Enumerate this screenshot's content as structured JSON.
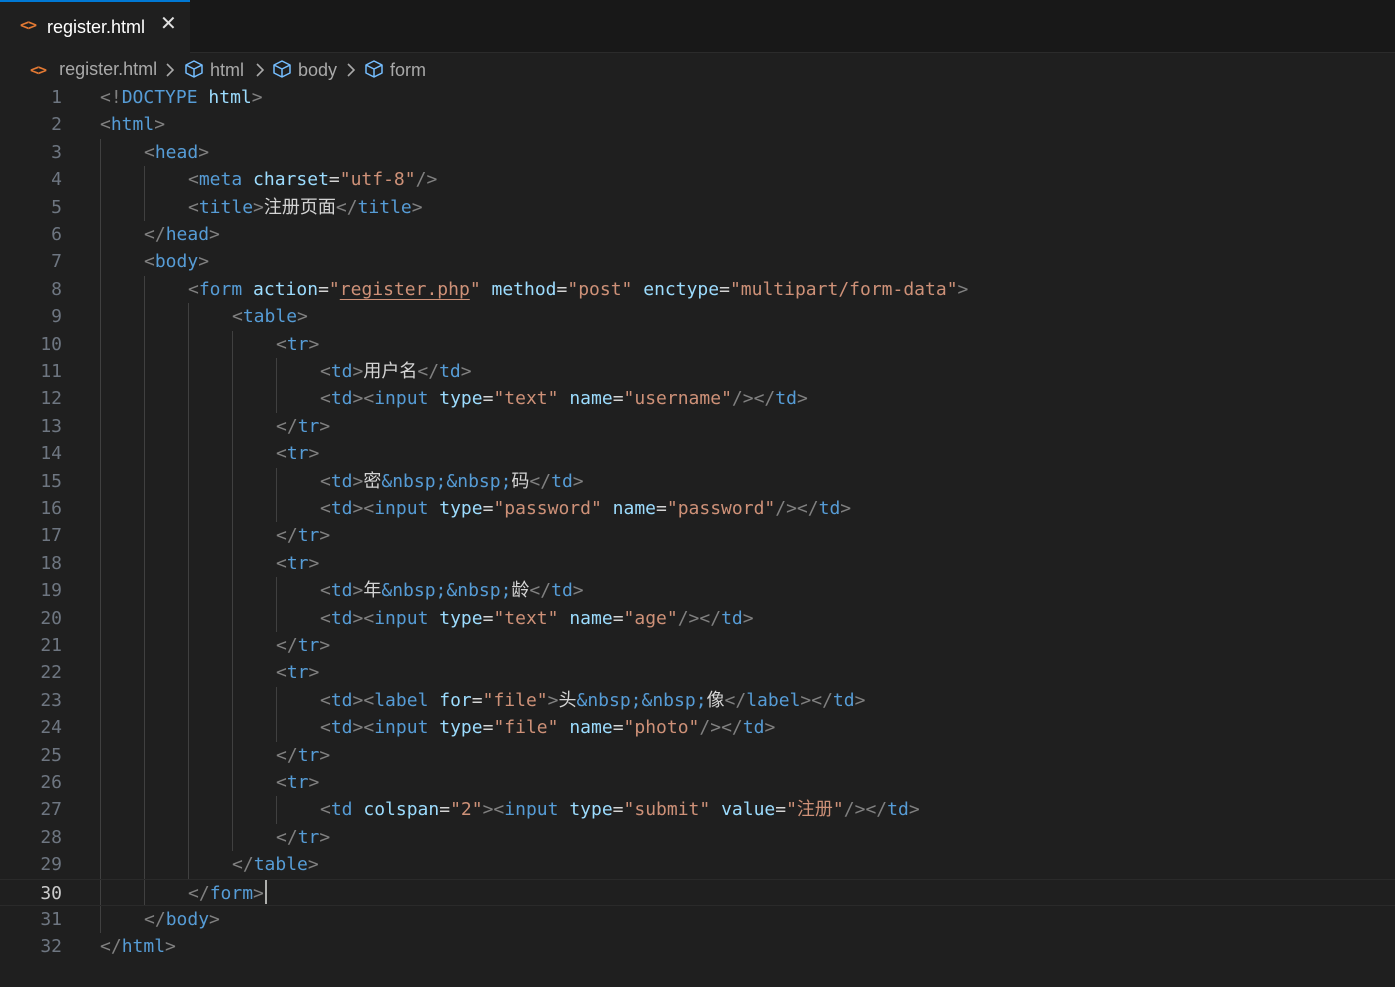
{
  "tab": {
    "file_icon": "<>",
    "filename": "register.html",
    "close_icon": "✕"
  },
  "breadcrumb": [
    {
      "label": "register.html",
      "icon": "html-file-icon"
    },
    {
      "label": "html",
      "icon": "cube-icon"
    },
    {
      "label": "body",
      "icon": "cube-icon"
    },
    {
      "label": "form",
      "icon": "cube-icon"
    }
  ],
  "editor": {
    "current_line": 30,
    "lines": [
      [
        [
          "p",
          "<!"
        ],
        [
          "t",
          "DOCTYPE"
        ],
        [
          "x",
          " "
        ],
        [
          "a",
          "html"
        ],
        [
          "p",
          ">"
        ]
      ],
      [
        [
          "p",
          "<"
        ],
        [
          "t",
          "html"
        ],
        [
          "p",
          ">"
        ]
      ],
      [
        [
          "x",
          "    "
        ],
        [
          "p",
          "<"
        ],
        [
          "t",
          "head"
        ],
        [
          "p",
          ">"
        ]
      ],
      [
        [
          "x",
          "        "
        ],
        [
          "p",
          "<"
        ],
        [
          "t",
          "meta"
        ],
        [
          "x",
          " "
        ],
        [
          "a",
          "charset"
        ],
        [
          "x",
          "="
        ],
        [
          "s",
          "\"utf-8\""
        ],
        [
          "p",
          "/>"
        ]
      ],
      [
        [
          "x",
          "        "
        ],
        [
          "p",
          "<"
        ],
        [
          "t",
          "title"
        ],
        [
          "p",
          ">"
        ],
        [
          "x",
          "注册页面"
        ],
        [
          "p",
          "</"
        ],
        [
          "t",
          "title"
        ],
        [
          "p",
          ">"
        ]
      ],
      [
        [
          "x",
          "    "
        ],
        [
          "p",
          "</"
        ],
        [
          "t",
          "head"
        ],
        [
          "p",
          ">"
        ]
      ],
      [
        [
          "x",
          "    "
        ],
        [
          "p",
          "<"
        ],
        [
          "t",
          "body"
        ],
        [
          "p",
          ">"
        ]
      ],
      [
        [
          "x",
          "        "
        ],
        [
          "p",
          "<"
        ],
        [
          "t",
          "form"
        ],
        [
          "x",
          " "
        ],
        [
          "a",
          "action"
        ],
        [
          "x",
          "="
        ],
        [
          "s",
          "\""
        ],
        [
          "u",
          "register.php"
        ],
        [
          "s",
          "\""
        ],
        [
          "x",
          " "
        ],
        [
          "a",
          "method"
        ],
        [
          "x",
          "="
        ],
        [
          "s",
          "\"post\""
        ],
        [
          "x",
          " "
        ],
        [
          "a",
          "enctype"
        ],
        [
          "x",
          "="
        ],
        [
          "s",
          "\"multipart/form-data\""
        ],
        [
          "p",
          ">"
        ]
      ],
      [
        [
          "x",
          "            "
        ],
        [
          "p",
          "<"
        ],
        [
          "t",
          "table"
        ],
        [
          "p",
          ">"
        ]
      ],
      [
        [
          "x",
          "                "
        ],
        [
          "p",
          "<"
        ],
        [
          "t",
          "tr"
        ],
        [
          "p",
          ">"
        ]
      ],
      [
        [
          "x",
          "                    "
        ],
        [
          "p",
          "<"
        ],
        [
          "t",
          "td"
        ],
        [
          "p",
          ">"
        ],
        [
          "x",
          "用户名"
        ],
        [
          "p",
          "</"
        ],
        [
          "t",
          "td"
        ],
        [
          "p",
          ">"
        ]
      ],
      [
        [
          "x",
          "                    "
        ],
        [
          "p",
          "<"
        ],
        [
          "t",
          "td"
        ],
        [
          "p",
          "><"
        ],
        [
          "t",
          "input"
        ],
        [
          "x",
          " "
        ],
        [
          "a",
          "type"
        ],
        [
          "x",
          "="
        ],
        [
          "s",
          "\"text\""
        ],
        [
          "x",
          " "
        ],
        [
          "a",
          "name"
        ],
        [
          "x",
          "="
        ],
        [
          "s",
          "\"username\""
        ],
        [
          "p",
          "/></"
        ],
        [
          "t",
          "td"
        ],
        [
          "p",
          ">"
        ]
      ],
      [
        [
          "x",
          "                "
        ],
        [
          "p",
          "</"
        ],
        [
          "t",
          "tr"
        ],
        [
          "p",
          ">"
        ]
      ],
      [
        [
          "x",
          "                "
        ],
        [
          "p",
          "<"
        ],
        [
          "t",
          "tr"
        ],
        [
          "p",
          ">"
        ]
      ],
      [
        [
          "x",
          "                    "
        ],
        [
          "p",
          "<"
        ],
        [
          "t",
          "td"
        ],
        [
          "p",
          ">"
        ],
        [
          "x",
          "密"
        ],
        [
          "e",
          "&nbsp;&nbsp;"
        ],
        [
          "x",
          "码"
        ],
        [
          "p",
          "</"
        ],
        [
          "t",
          "td"
        ],
        [
          "p",
          ">"
        ]
      ],
      [
        [
          "x",
          "                    "
        ],
        [
          "p",
          "<"
        ],
        [
          "t",
          "td"
        ],
        [
          "p",
          "><"
        ],
        [
          "t",
          "input"
        ],
        [
          "x",
          " "
        ],
        [
          "a",
          "type"
        ],
        [
          "x",
          "="
        ],
        [
          "s",
          "\"password\""
        ],
        [
          "x",
          " "
        ],
        [
          "a",
          "name"
        ],
        [
          "x",
          "="
        ],
        [
          "s",
          "\"password\""
        ],
        [
          "p",
          "/></"
        ],
        [
          "t",
          "td"
        ],
        [
          "p",
          ">"
        ]
      ],
      [
        [
          "x",
          "                "
        ],
        [
          "p",
          "</"
        ],
        [
          "t",
          "tr"
        ],
        [
          "p",
          ">"
        ]
      ],
      [
        [
          "x",
          "                "
        ],
        [
          "p",
          "<"
        ],
        [
          "t",
          "tr"
        ],
        [
          "p",
          ">"
        ]
      ],
      [
        [
          "x",
          "                    "
        ],
        [
          "p",
          "<"
        ],
        [
          "t",
          "td"
        ],
        [
          "p",
          ">"
        ],
        [
          "x",
          "年"
        ],
        [
          "e",
          "&nbsp;&nbsp;"
        ],
        [
          "x",
          "龄"
        ],
        [
          "p",
          "</"
        ],
        [
          "t",
          "td"
        ],
        [
          "p",
          ">"
        ]
      ],
      [
        [
          "x",
          "                    "
        ],
        [
          "p",
          "<"
        ],
        [
          "t",
          "td"
        ],
        [
          "p",
          "><"
        ],
        [
          "t",
          "input"
        ],
        [
          "x",
          " "
        ],
        [
          "a",
          "type"
        ],
        [
          "x",
          "="
        ],
        [
          "s",
          "\"text\""
        ],
        [
          "x",
          " "
        ],
        [
          "a",
          "name"
        ],
        [
          "x",
          "="
        ],
        [
          "s",
          "\"age\""
        ],
        [
          "p",
          "/></"
        ],
        [
          "t",
          "td"
        ],
        [
          "p",
          ">"
        ]
      ],
      [
        [
          "x",
          "                "
        ],
        [
          "p",
          "</"
        ],
        [
          "t",
          "tr"
        ],
        [
          "p",
          ">"
        ]
      ],
      [
        [
          "x",
          "                "
        ],
        [
          "p",
          "<"
        ],
        [
          "t",
          "tr"
        ],
        [
          "p",
          ">"
        ]
      ],
      [
        [
          "x",
          "                    "
        ],
        [
          "p",
          "<"
        ],
        [
          "t",
          "td"
        ],
        [
          "p",
          "><"
        ],
        [
          "t",
          "label"
        ],
        [
          "x",
          " "
        ],
        [
          "a",
          "for"
        ],
        [
          "x",
          "="
        ],
        [
          "s",
          "\"file\""
        ],
        [
          "p",
          ">"
        ],
        [
          "x",
          "头"
        ],
        [
          "e",
          "&nbsp;&nbsp;"
        ],
        [
          "x",
          "像"
        ],
        [
          "p",
          "</"
        ],
        [
          "t",
          "label"
        ],
        [
          "p",
          "></"
        ],
        [
          "t",
          "td"
        ],
        [
          "p",
          ">"
        ]
      ],
      [
        [
          "x",
          "                    "
        ],
        [
          "p",
          "<"
        ],
        [
          "t",
          "td"
        ],
        [
          "p",
          "><"
        ],
        [
          "t",
          "input"
        ],
        [
          "x",
          " "
        ],
        [
          "a",
          "type"
        ],
        [
          "x",
          "="
        ],
        [
          "s",
          "\"file\""
        ],
        [
          "x",
          " "
        ],
        [
          "a",
          "name"
        ],
        [
          "x",
          "="
        ],
        [
          "s",
          "\"photo\""
        ],
        [
          "p",
          "/></"
        ],
        [
          "t",
          "td"
        ],
        [
          "p",
          ">"
        ]
      ],
      [
        [
          "x",
          "                "
        ],
        [
          "p",
          "</"
        ],
        [
          "t",
          "tr"
        ],
        [
          "p",
          ">"
        ]
      ],
      [
        [
          "x",
          "                "
        ],
        [
          "p",
          "<"
        ],
        [
          "t",
          "tr"
        ],
        [
          "p",
          ">"
        ]
      ],
      [
        [
          "x",
          "                    "
        ],
        [
          "p",
          "<"
        ],
        [
          "t",
          "td"
        ],
        [
          "x",
          " "
        ],
        [
          "a",
          "colspan"
        ],
        [
          "x",
          "="
        ],
        [
          "s",
          "\"2\""
        ],
        [
          "p",
          "><"
        ],
        [
          "t",
          "input"
        ],
        [
          "x",
          " "
        ],
        [
          "a",
          "type"
        ],
        [
          "x",
          "="
        ],
        [
          "s",
          "\"submit\""
        ],
        [
          "x",
          " "
        ],
        [
          "a",
          "value"
        ],
        [
          "x",
          "="
        ],
        [
          "s",
          "\"注册\""
        ],
        [
          "p",
          "/></"
        ],
        [
          "t",
          "td"
        ],
        [
          "p",
          ">"
        ]
      ],
      [
        [
          "x",
          "                "
        ],
        [
          "p",
          "</"
        ],
        [
          "t",
          "tr"
        ],
        [
          "p",
          ">"
        ]
      ],
      [
        [
          "x",
          "            "
        ],
        [
          "p",
          "</"
        ],
        [
          "t",
          "table"
        ],
        [
          "p",
          ">"
        ]
      ],
      [
        [
          "x",
          "        "
        ],
        [
          "p",
          "</"
        ],
        [
          "t",
          "form"
        ],
        [
          "p",
          ">"
        ]
      ],
      [
        [
          "x",
          "    "
        ],
        [
          "p",
          "</"
        ],
        [
          "t",
          "body"
        ],
        [
          "p",
          ">"
        ]
      ],
      [
        [
          "p",
          "</"
        ],
        [
          "t",
          "html"
        ],
        [
          "p",
          ">"
        ]
      ]
    ]
  }
}
